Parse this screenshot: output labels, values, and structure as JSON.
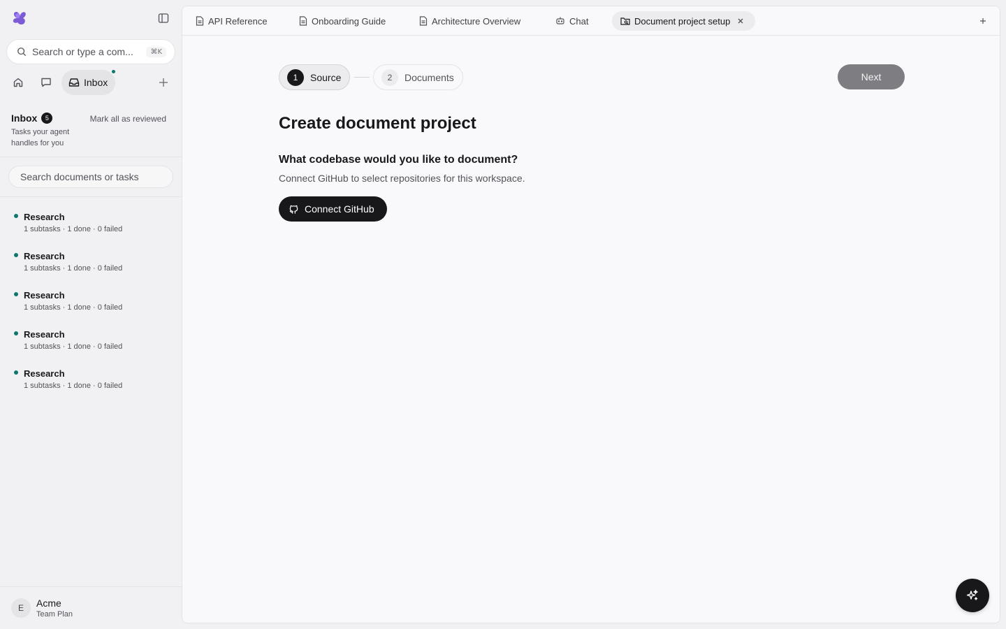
{
  "sidebar": {
    "logo_icon": "app-logo",
    "command_search": {
      "placeholder": "Search or type a com...",
      "shortcut": "⌘K"
    },
    "nav": {
      "inbox_label": "Inbox",
      "inbox_has_unread": true
    },
    "inbox": {
      "title": "Inbox",
      "count": "5",
      "description": "Tasks your agent handles for you",
      "mark_all_label": "Mark all as reviewed"
    },
    "doc_search_placeholder": "Search documents or tasks",
    "tasks": [
      {
        "title": "Research",
        "meta": "1 subtasks · 1 done · 0 failed"
      },
      {
        "title": "Research",
        "meta": "1 subtasks · 1 done · 0 failed"
      },
      {
        "title": "Research",
        "meta": "1 subtasks · 1 done · 0 failed"
      },
      {
        "title": "Research",
        "meta": "1 subtasks · 1 done · 0 failed"
      },
      {
        "title": "Research",
        "meta": "1 subtasks · 1 done · 0 failed"
      }
    ],
    "user": {
      "initial": "E",
      "name": "Acme",
      "plan": "Team Plan"
    }
  },
  "tabs": [
    {
      "label": "API Reference",
      "icon": "document-icon"
    },
    {
      "label": "Onboarding Guide",
      "icon": "document-icon"
    },
    {
      "label": "Architecture Overview",
      "icon": "document-icon"
    },
    {
      "label": "Chat",
      "icon": "bot-icon"
    },
    {
      "label": "Document project setup",
      "icon": "folder-icon",
      "active": true
    }
  ],
  "stepper": {
    "steps": [
      {
        "number": "1",
        "label": "Source",
        "active": true
      },
      {
        "number": "2",
        "label": "Documents",
        "active": false
      }
    ],
    "next_label": "Next"
  },
  "main": {
    "title": "Create document project",
    "question": "What codebase would you like to document?",
    "help": "Connect GitHub to select repositories for this workspace.",
    "connect_label": "Connect GitHub"
  },
  "colors": {
    "accent": "#18181b",
    "status_dot": "#0f766e",
    "next_disabled": "#7d7d82"
  }
}
